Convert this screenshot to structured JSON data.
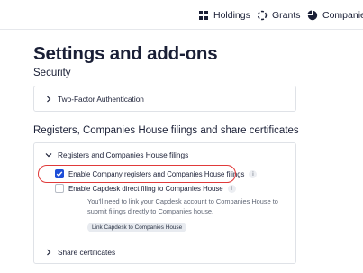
{
  "nav": {
    "holdings": "Holdings",
    "grants": "Grants",
    "companies": "Companies"
  },
  "page": {
    "title": "Settings and add-ons"
  },
  "security": {
    "heading": "Security",
    "two_factor": "Two-Factor Authentication"
  },
  "registers": {
    "heading": "Registers, Companies House filings and share certificates",
    "panel_title": "Registers and Companies House filings",
    "option_registers": "Enable Company registers and Companies House filings",
    "option_registers_checked": true,
    "option_capdesk": "Enable Capdesk direct filing to Companies House",
    "option_capdesk_checked": false,
    "capdesk_note": "You'll need to link your Capdesk account to Companies House to submit filings directly to Companies house.",
    "link_button": "Link Capdesk to Companies House",
    "share_certificates": "Share certificates"
  },
  "colors": {
    "accent": "#1d4ed8",
    "highlight": "#e03a3a"
  },
  "icons": {
    "holdings": "grid-icon",
    "grants": "dashed-circle-icon",
    "companies": "pie-chart-icon",
    "info": "info-icon",
    "chevron_right": "chevron-right-icon",
    "chevron_down": "chevron-down-icon",
    "check": "check-icon"
  }
}
